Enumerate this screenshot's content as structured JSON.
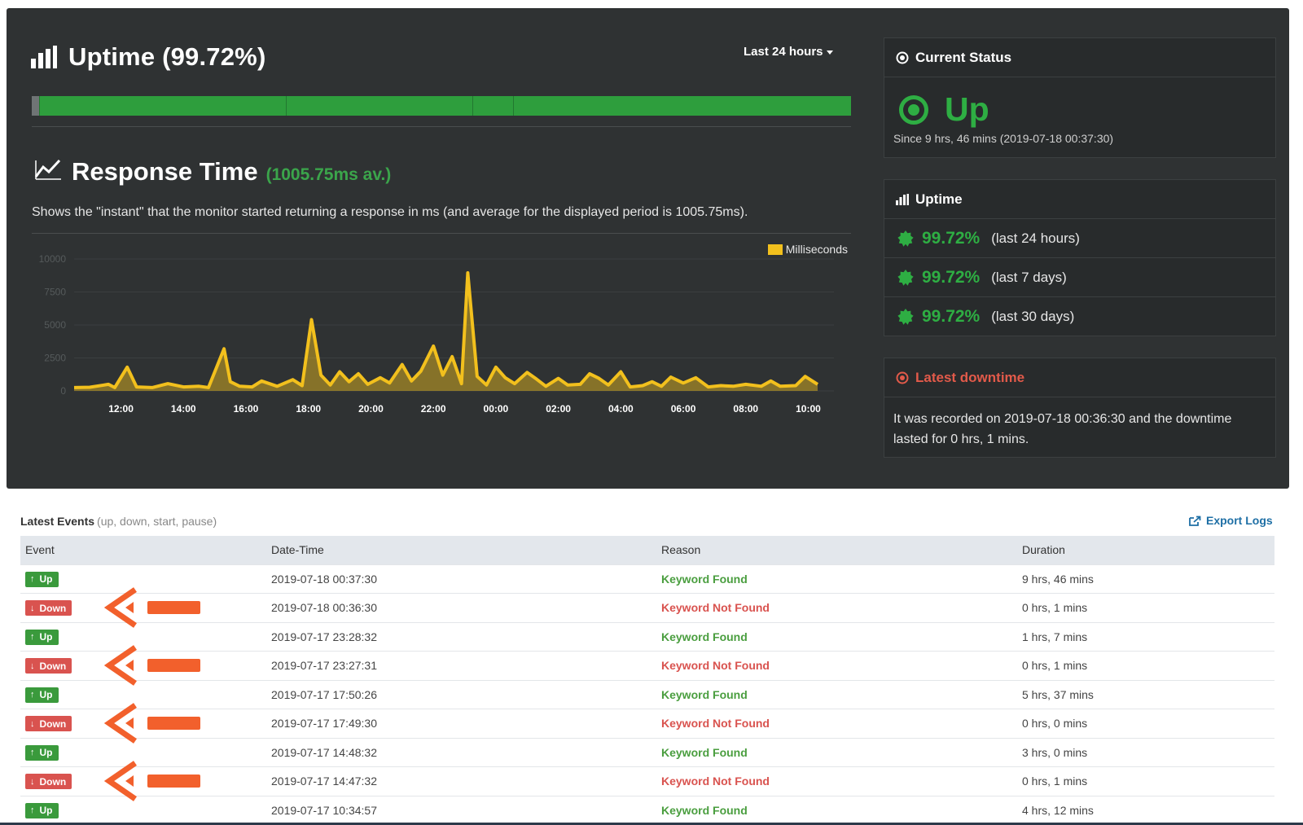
{
  "uptime": {
    "title": "Uptime (99.72%)",
    "range_label": "Last 24 hours"
  },
  "response_time": {
    "title": "Response Time",
    "average": "(1005.75ms av.)",
    "description": "Shows the \"instant\" that the monitor started returning a response in ms (and average for the displayed period is 1005.75ms)."
  },
  "chart_data": {
    "type": "area",
    "series": [
      {
        "name": "Milliseconds"
      }
    ],
    "yticks": [
      "0",
      "2500",
      "5000",
      "7500",
      "10000"
    ],
    "xticks": [
      "12:00",
      "14:00",
      "16:00",
      "18:00",
      "20:00",
      "22:00",
      "00:00",
      "02:00",
      "04:00",
      "06:00",
      "08:00",
      "10:00"
    ],
    "ylim": [
      0,
      10000
    ],
    "x_start_hour": 10.5,
    "x_end_hour": 34.3,
    "points": [
      [
        10.5,
        250
      ],
      [
        11,
        280
      ],
      [
        11.6,
        500
      ],
      [
        11.8,
        250
      ],
      [
        12.2,
        1800
      ],
      [
        12.5,
        300
      ],
      [
        13,
        250
      ],
      [
        13.5,
        550
      ],
      [
        14,
        300
      ],
      [
        14.5,
        350
      ],
      [
        14.8,
        250
      ],
      [
        15.3,
        3200
      ],
      [
        15.5,
        700
      ],
      [
        15.8,
        350
      ],
      [
        16.2,
        300
      ],
      [
        16.5,
        750
      ],
      [
        17,
        350
      ],
      [
        17.5,
        850
      ],
      [
        17.8,
        400
      ],
      [
        18.1,
        5400
      ],
      [
        18.4,
        1200
      ],
      [
        18.7,
        450
      ],
      [
        19,
        1450
      ],
      [
        19.3,
        700
      ],
      [
        19.6,
        1300
      ],
      [
        19.9,
        500
      ],
      [
        20.3,
        1000
      ],
      [
        20.6,
        600
      ],
      [
        21,
        2000
      ],
      [
        21.3,
        750
      ],
      [
        21.6,
        1500
      ],
      [
        22,
        3400
      ],
      [
        22.3,
        1200
      ],
      [
        22.6,
        2600
      ],
      [
        22.9,
        550
      ],
      [
        23.1,
        8950
      ],
      [
        23.4,
        1100
      ],
      [
        23.7,
        450
      ],
      [
        24,
        1800
      ],
      [
        24.3,
        1000
      ],
      [
        24.6,
        550
      ],
      [
        25,
        1400
      ],
      [
        25.3,
        900
      ],
      [
        25.6,
        350
      ],
      [
        26,
        950
      ],
      [
        26.3,
        450
      ],
      [
        26.7,
        500
      ],
      [
        27,
        1300
      ],
      [
        27.3,
        950
      ],
      [
        27.6,
        450
      ],
      [
        28,
        1450
      ],
      [
        28.3,
        300
      ],
      [
        28.7,
        400
      ],
      [
        29,
        700
      ],
      [
        29.3,
        350
      ],
      [
        29.6,
        1050
      ],
      [
        30,
        600
      ],
      [
        30.4,
        1000
      ],
      [
        30.8,
        300
      ],
      [
        31.2,
        400
      ],
      [
        31.6,
        350
      ],
      [
        32,
        500
      ],
      [
        32.5,
        350
      ],
      [
        32.8,
        750
      ],
      [
        33.1,
        350
      ],
      [
        33.6,
        400
      ],
      [
        33.9,
        1100
      ],
      [
        34.3,
        500
      ]
    ]
  },
  "current_status": {
    "header": "Current Status",
    "state": "Up",
    "since": "Since 9 hrs, 46 mins (2019-07-18 00:37:30)"
  },
  "uptime_card": {
    "header": "Uptime",
    "rows": [
      {
        "pct": "99.72%",
        "period": "(last 24 hours)"
      },
      {
        "pct": "99.72%",
        "period": "(last 7 days)"
      },
      {
        "pct": "99.72%",
        "period": "(last 30 days)"
      }
    ]
  },
  "latest_downtime": {
    "header": "Latest downtime",
    "text": "It was recorded on 2019-07-18 00:36:30 and the downtime lasted for 0 hrs, 1 mins."
  },
  "events": {
    "title": "Latest Events",
    "subtitle": "(up, down, start, pause)",
    "export_label": "Export Logs",
    "columns": [
      "Event",
      "Date-Time",
      "Reason",
      "Duration"
    ],
    "rows": [
      {
        "event": "Up",
        "datetime": "2019-07-18 00:37:30",
        "reason": "Keyword Found",
        "duration": "9 hrs, 46 mins"
      },
      {
        "event": "Down",
        "datetime": "2019-07-18 00:36:30",
        "reason": "Keyword Not Found",
        "duration": "0 hrs, 1 mins"
      },
      {
        "event": "Up",
        "datetime": "2019-07-17 23:28:32",
        "reason": "Keyword Found",
        "duration": "1 hrs, 7 mins"
      },
      {
        "event": "Down",
        "datetime": "2019-07-17 23:27:31",
        "reason": "Keyword Not Found",
        "duration": "0 hrs, 1 mins"
      },
      {
        "event": "Up",
        "datetime": "2019-07-17 17:50:26",
        "reason": "Keyword Found",
        "duration": "5 hrs, 37 mins"
      },
      {
        "event": "Down",
        "datetime": "2019-07-17 17:49:30",
        "reason": "Keyword Not Found",
        "duration": "0 hrs, 0 mins"
      },
      {
        "event": "Up",
        "datetime": "2019-07-17 14:48:32",
        "reason": "Keyword Found",
        "duration": "3 hrs, 0 mins"
      },
      {
        "event": "Down",
        "datetime": "2019-07-17 14:47:32",
        "reason": "Keyword Not Found",
        "duration": "0 hrs, 1 mins"
      },
      {
        "event": "Up",
        "datetime": "2019-07-17 10:34:57",
        "reason": "Keyword Found",
        "duration": "4 hrs, 12 mins"
      }
    ]
  },
  "colors": {
    "up": "#2eae43",
    "down": "#d9534f",
    "series": "#f2c01d",
    "annotation": "#f2602c"
  },
  "icons": {
    "uptime": "bar-chart-icon",
    "response": "line-chart-icon",
    "status": "dot-circle-icon",
    "burst": "certificate-icon",
    "export": "external-link-icon",
    "arrow_up": "arrow-up-icon",
    "arrow_down": "arrow-down-icon"
  }
}
